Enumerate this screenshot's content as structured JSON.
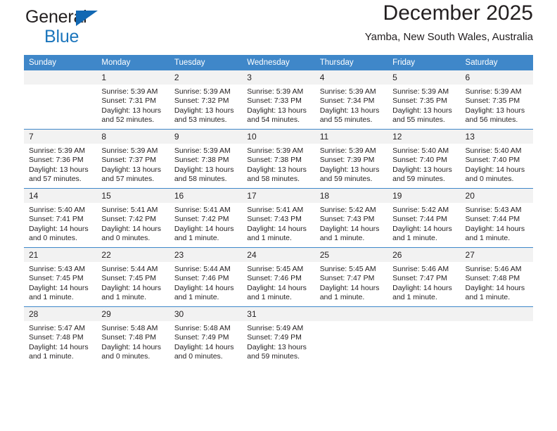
{
  "brand": {
    "line1": "General",
    "line2": "Blue",
    "triangle_color": "#1268b3",
    "line2_color": "#1b75bc"
  },
  "header": {
    "title": "December 2025",
    "subtitle": "Yamba, New South Wales, Australia"
  },
  "theme": {
    "header_bg": "#3f87c9",
    "daynum_bg": "#f2f2f2",
    "grid_line": "#3f87c9",
    "text": "#231f20"
  },
  "weekdays": [
    "Sunday",
    "Monday",
    "Tuesday",
    "Wednesday",
    "Thursday",
    "Friday",
    "Saturday"
  ],
  "weeks": [
    [
      {
        "day": "",
        "sunrise": "",
        "sunset": "",
        "daylight1": "",
        "daylight2": ""
      },
      {
        "day": "1",
        "sunrise": "Sunrise: 5:39 AM",
        "sunset": "Sunset: 7:31 PM",
        "daylight1": "Daylight: 13 hours",
        "daylight2": "and 52 minutes."
      },
      {
        "day": "2",
        "sunrise": "Sunrise: 5:39 AM",
        "sunset": "Sunset: 7:32 PM",
        "daylight1": "Daylight: 13 hours",
        "daylight2": "and 53 minutes."
      },
      {
        "day": "3",
        "sunrise": "Sunrise: 5:39 AM",
        "sunset": "Sunset: 7:33 PM",
        "daylight1": "Daylight: 13 hours",
        "daylight2": "and 54 minutes."
      },
      {
        "day": "4",
        "sunrise": "Sunrise: 5:39 AM",
        "sunset": "Sunset: 7:34 PM",
        "daylight1": "Daylight: 13 hours",
        "daylight2": "and 55 minutes."
      },
      {
        "day": "5",
        "sunrise": "Sunrise: 5:39 AM",
        "sunset": "Sunset: 7:35 PM",
        "daylight1": "Daylight: 13 hours",
        "daylight2": "and 55 minutes."
      },
      {
        "day": "6",
        "sunrise": "Sunrise: 5:39 AM",
        "sunset": "Sunset: 7:35 PM",
        "daylight1": "Daylight: 13 hours",
        "daylight2": "and 56 minutes."
      }
    ],
    [
      {
        "day": "7",
        "sunrise": "Sunrise: 5:39 AM",
        "sunset": "Sunset: 7:36 PM",
        "daylight1": "Daylight: 13 hours",
        "daylight2": "and 57 minutes."
      },
      {
        "day": "8",
        "sunrise": "Sunrise: 5:39 AM",
        "sunset": "Sunset: 7:37 PM",
        "daylight1": "Daylight: 13 hours",
        "daylight2": "and 57 minutes."
      },
      {
        "day": "9",
        "sunrise": "Sunrise: 5:39 AM",
        "sunset": "Sunset: 7:38 PM",
        "daylight1": "Daylight: 13 hours",
        "daylight2": "and 58 minutes."
      },
      {
        "day": "10",
        "sunrise": "Sunrise: 5:39 AM",
        "sunset": "Sunset: 7:38 PM",
        "daylight1": "Daylight: 13 hours",
        "daylight2": "and 58 minutes."
      },
      {
        "day": "11",
        "sunrise": "Sunrise: 5:39 AM",
        "sunset": "Sunset: 7:39 PM",
        "daylight1": "Daylight: 13 hours",
        "daylight2": "and 59 minutes."
      },
      {
        "day": "12",
        "sunrise": "Sunrise: 5:40 AM",
        "sunset": "Sunset: 7:40 PM",
        "daylight1": "Daylight: 13 hours",
        "daylight2": "and 59 minutes."
      },
      {
        "day": "13",
        "sunrise": "Sunrise: 5:40 AM",
        "sunset": "Sunset: 7:40 PM",
        "daylight1": "Daylight: 14 hours",
        "daylight2": "and 0 minutes."
      }
    ],
    [
      {
        "day": "14",
        "sunrise": "Sunrise: 5:40 AM",
        "sunset": "Sunset: 7:41 PM",
        "daylight1": "Daylight: 14 hours",
        "daylight2": "and 0 minutes."
      },
      {
        "day": "15",
        "sunrise": "Sunrise: 5:41 AM",
        "sunset": "Sunset: 7:42 PM",
        "daylight1": "Daylight: 14 hours",
        "daylight2": "and 0 minutes."
      },
      {
        "day": "16",
        "sunrise": "Sunrise: 5:41 AM",
        "sunset": "Sunset: 7:42 PM",
        "daylight1": "Daylight: 14 hours",
        "daylight2": "and 1 minute."
      },
      {
        "day": "17",
        "sunrise": "Sunrise: 5:41 AM",
        "sunset": "Sunset: 7:43 PM",
        "daylight1": "Daylight: 14 hours",
        "daylight2": "and 1 minute."
      },
      {
        "day": "18",
        "sunrise": "Sunrise: 5:42 AM",
        "sunset": "Sunset: 7:43 PM",
        "daylight1": "Daylight: 14 hours",
        "daylight2": "and 1 minute."
      },
      {
        "day": "19",
        "sunrise": "Sunrise: 5:42 AM",
        "sunset": "Sunset: 7:44 PM",
        "daylight1": "Daylight: 14 hours",
        "daylight2": "and 1 minute."
      },
      {
        "day": "20",
        "sunrise": "Sunrise: 5:43 AM",
        "sunset": "Sunset: 7:44 PM",
        "daylight1": "Daylight: 14 hours",
        "daylight2": "and 1 minute."
      }
    ],
    [
      {
        "day": "21",
        "sunrise": "Sunrise: 5:43 AM",
        "sunset": "Sunset: 7:45 PM",
        "daylight1": "Daylight: 14 hours",
        "daylight2": "and 1 minute."
      },
      {
        "day": "22",
        "sunrise": "Sunrise: 5:44 AM",
        "sunset": "Sunset: 7:45 PM",
        "daylight1": "Daylight: 14 hours",
        "daylight2": "and 1 minute."
      },
      {
        "day": "23",
        "sunrise": "Sunrise: 5:44 AM",
        "sunset": "Sunset: 7:46 PM",
        "daylight1": "Daylight: 14 hours",
        "daylight2": "and 1 minute."
      },
      {
        "day": "24",
        "sunrise": "Sunrise: 5:45 AM",
        "sunset": "Sunset: 7:46 PM",
        "daylight1": "Daylight: 14 hours",
        "daylight2": "and 1 minute."
      },
      {
        "day": "25",
        "sunrise": "Sunrise: 5:45 AM",
        "sunset": "Sunset: 7:47 PM",
        "daylight1": "Daylight: 14 hours",
        "daylight2": "and 1 minute."
      },
      {
        "day": "26",
        "sunrise": "Sunrise: 5:46 AM",
        "sunset": "Sunset: 7:47 PM",
        "daylight1": "Daylight: 14 hours",
        "daylight2": "and 1 minute."
      },
      {
        "day": "27",
        "sunrise": "Sunrise: 5:46 AM",
        "sunset": "Sunset: 7:48 PM",
        "daylight1": "Daylight: 14 hours",
        "daylight2": "and 1 minute."
      }
    ],
    [
      {
        "day": "28",
        "sunrise": "Sunrise: 5:47 AM",
        "sunset": "Sunset: 7:48 PM",
        "daylight1": "Daylight: 14 hours",
        "daylight2": "and 1 minute."
      },
      {
        "day": "29",
        "sunrise": "Sunrise: 5:48 AM",
        "sunset": "Sunset: 7:48 PM",
        "daylight1": "Daylight: 14 hours",
        "daylight2": "and 0 minutes."
      },
      {
        "day": "30",
        "sunrise": "Sunrise: 5:48 AM",
        "sunset": "Sunset: 7:49 PM",
        "daylight1": "Daylight: 14 hours",
        "daylight2": "and 0 minutes."
      },
      {
        "day": "31",
        "sunrise": "Sunrise: 5:49 AM",
        "sunset": "Sunset: 7:49 PM",
        "daylight1": "Daylight: 13 hours",
        "daylight2": "and 59 minutes."
      },
      {
        "day": "",
        "sunrise": "",
        "sunset": "",
        "daylight1": "",
        "daylight2": ""
      },
      {
        "day": "",
        "sunrise": "",
        "sunset": "",
        "daylight1": "",
        "daylight2": ""
      },
      {
        "day": "",
        "sunrise": "",
        "sunset": "",
        "daylight1": "",
        "daylight2": ""
      }
    ]
  ]
}
